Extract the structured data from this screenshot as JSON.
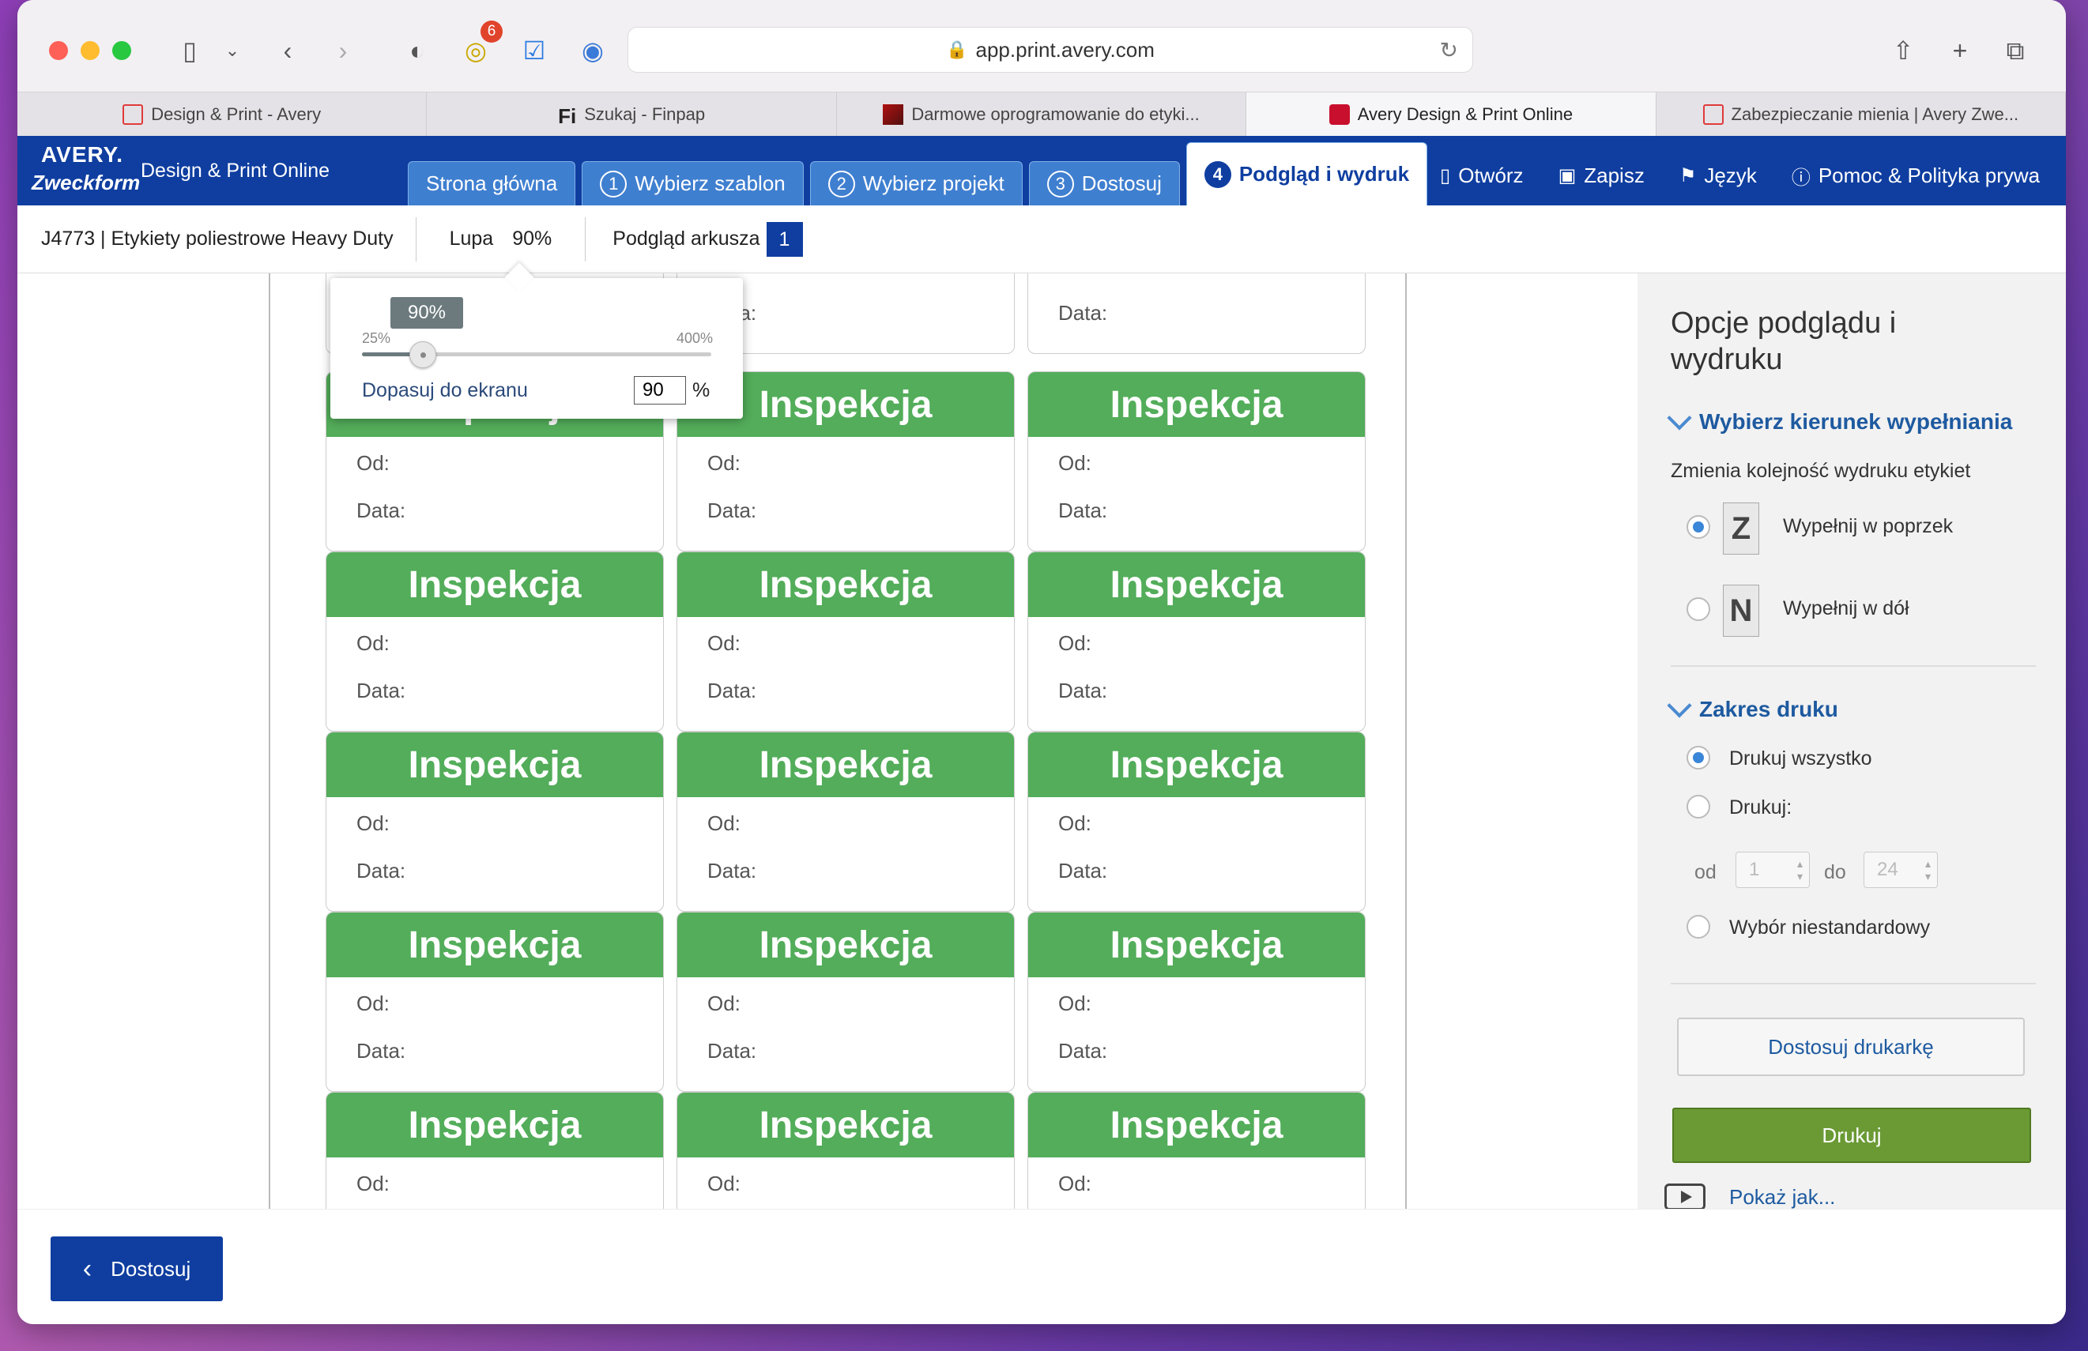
{
  "browser": {
    "url": "app.print.avery.com",
    "extension_badge": "6",
    "tabs": [
      {
        "label": "Design & Print - Avery",
        "favicon": "avery-outline-icon"
      },
      {
        "label": "Szukaj - Finpap",
        "favicon": "finpap-icon"
      },
      {
        "label": "Darmowe oprogramowanie do etyki...",
        "favicon": "triangle-logo-icon"
      },
      {
        "label": "Avery Design & Print Online",
        "favicon": "avery-icon",
        "active": true
      },
      {
        "label": "Zabezpieczanie mienia | Avery Zwe...",
        "favicon": "avery-outline-icon"
      }
    ]
  },
  "app": {
    "logo_top": "AVERY.",
    "logo_bottom": "Zweckform",
    "title": "Design & Print Online",
    "steps": [
      {
        "num": "",
        "label": "Strona główna"
      },
      {
        "num": "1",
        "label": "Wybierz szablon"
      },
      {
        "num": "2",
        "label": "Wybierz projekt"
      },
      {
        "num": "3",
        "label": "Dostosuj"
      },
      {
        "num": "4",
        "label": "Podgląd i wydruk",
        "active": true
      }
    ],
    "links": {
      "open": "Otwórz",
      "save": "Zapisz",
      "language": "Język",
      "help": "Pomoc & Polityka prywa"
    }
  },
  "subbar": {
    "product": "J4773 | Etykiety poliestrowe Heavy Duty",
    "zoom_label": "Lupa",
    "zoom_value": "90%",
    "preview_label": "Podgląd arkusza",
    "preview_page": "1"
  },
  "zoom_popover": {
    "tooltip": "90%",
    "min": "25%",
    "max": "400%",
    "value_fraction": 0.174,
    "fit_label": "Dopasuj do ekranu",
    "input_value": "90",
    "unit": "%"
  },
  "label_template": {
    "heading": "Inspekcja",
    "from": "Od:",
    "date": "Data:",
    "partial_heading": "Inspekcja",
    "partial_date": "a:"
  },
  "panel": {
    "title": "Opcje podglądu i wydruku",
    "fill_section": "Wybierz kierunek wypełniania",
    "fill_desc": "Zmienia kolejność wydruku etykiet",
    "fill_across": "Wypełnij w poprzek",
    "fill_down": "Wypełnij w dół",
    "range_section": "Zakres druku",
    "print_all": "Drukuj wszystko",
    "print_some": "Drukuj:",
    "from_label": "od",
    "from_value": "1",
    "to_label": "do",
    "to_value": "24",
    "custom": "Wybór niestandardowy",
    "adjust_printer": "Dostosuj drukarkę",
    "print": "Drukuj",
    "show_how": "Pokaż jak..."
  },
  "bottom": {
    "back": "Dostosuj"
  }
}
